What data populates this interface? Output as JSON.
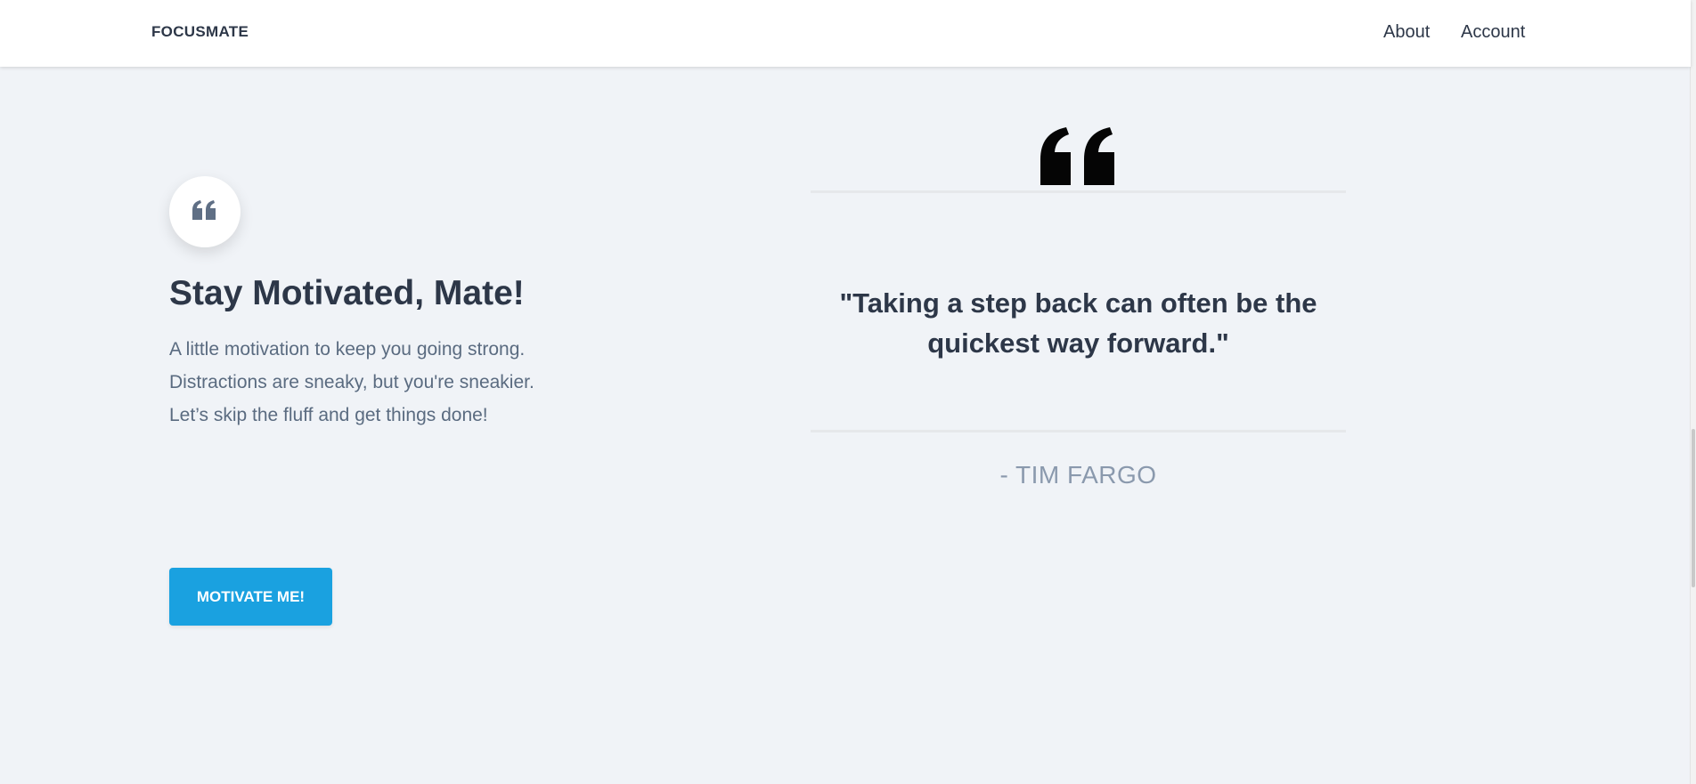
{
  "header": {
    "brand": "FOCUSMATE",
    "nav": [
      {
        "label": "About"
      },
      {
        "label": "Account"
      }
    ]
  },
  "hero": {
    "icon": "quote-icon",
    "title": "Stay Motivated, Mate!",
    "lines": [
      "A little motivation to keep you going strong.",
      "Distractions are sneaky, but you're sneakier.",
      "Let’s skip the fluff and get things done!"
    ],
    "button_label": "MOTIVATE ME!"
  },
  "quote": {
    "icon": "large-quote-icon",
    "text": "\"Taking a step back can often be the quickest way forward.\"",
    "author": "- TIM FARGO"
  },
  "colors": {
    "background": "#f0f3f7",
    "accent": "#1aa1e0",
    "text": "#2d3748",
    "muted": "#5a6b80",
    "author": "#8a99ad"
  }
}
